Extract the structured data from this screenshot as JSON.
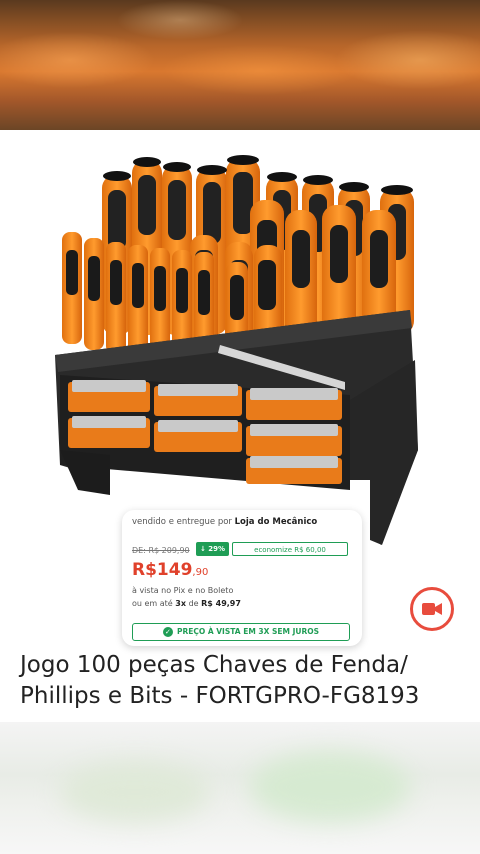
{
  "product": {
    "title_line1": "Jogo 100 peças Chaves de Fenda/",
    "title_line2": "Phillips e Bits - FORTGPRO-FG8193"
  },
  "price_card": {
    "seller_prefix": "vendido e entregue por",
    "seller_name": "Loja do Mecânico",
    "old_price": "DE: R$ 209,90",
    "discount": "↓ 29%",
    "savings": "economize R$ 60,00",
    "price_main": "R$149",
    "price_cents": ",90",
    "payment_line1": "à vista no Pix e no Boleto",
    "payment_line2_prefix": "ou em até",
    "installments": "3x",
    "payment_line2_mid": "de",
    "installment_value": "R$ 49,97",
    "pix_banner": "PREÇO À VISTA EM 3X SEM JUROS"
  },
  "icons": {
    "camera": "video-camera-icon",
    "check": "check-circle-icon"
  },
  "colors": {
    "accent_orange": "#f28a1e",
    "price_red": "#e0412b",
    "green": "#1f9d55",
    "camera_red": "#e84c3d"
  }
}
